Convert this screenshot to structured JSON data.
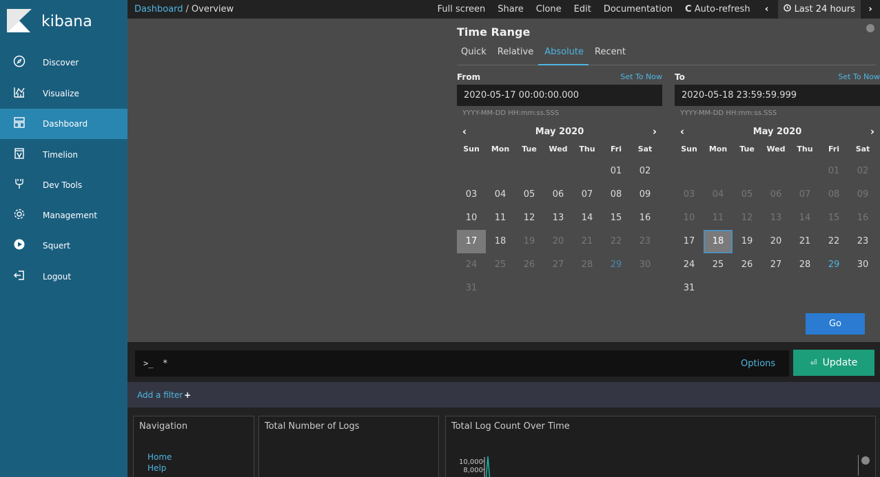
{
  "sidebar": {
    "brand": "kibana",
    "items": [
      {
        "label": "Discover",
        "icon": "compass-icon"
      },
      {
        "label": "Visualize",
        "icon": "chart-icon"
      },
      {
        "label": "Dashboard",
        "icon": "dashboard-icon"
      },
      {
        "label": "Timelion",
        "icon": "timelion-icon"
      },
      {
        "label": "Dev Tools",
        "icon": "wrench-icon"
      },
      {
        "label": "Management",
        "icon": "gear-icon"
      },
      {
        "label": "Squert",
        "icon": "play-icon"
      },
      {
        "label": "Logout",
        "icon": "logout-icon"
      }
    ],
    "active": "Dashboard"
  },
  "topbar": {
    "breadcrumb_link": "Dashboard",
    "breadcrumb_sep": "/",
    "breadcrumb_current": "Overview",
    "full_screen": "Full screen",
    "share": "Share",
    "clone": "Clone",
    "edit": "Edit",
    "documentation": "Documentation",
    "auto_refresh": "Auto-refresh",
    "time_label": "Last 24 hours"
  },
  "time_range": {
    "title": "Time Range",
    "tabs": [
      "Quick",
      "Relative",
      "Absolute",
      "Recent"
    ],
    "active_tab": "Absolute",
    "from": {
      "label": "From",
      "set_to_now": "Set To Now",
      "value": "2020-05-17 00:00:00.000",
      "format": "YYYY-MM-DD HH:mm:ss.SSS",
      "month": "May 2020",
      "selected": "17"
    },
    "to": {
      "label": "To",
      "set_to_now": "Set To Now",
      "value": "2020-05-18 23:59:59.999",
      "format": "YYYY-MM-DD HH:mm:ss.SSS",
      "month": "May 2020",
      "selected": "18"
    },
    "weekdays": [
      "Sun",
      "Mon",
      "Tue",
      "Wed",
      "Thu",
      "Fri",
      "Sat"
    ],
    "go": "Go"
  },
  "query": {
    "prompt": ">_",
    "value": "*",
    "options": "Options",
    "update": "Update"
  },
  "filter": {
    "add_filter": "Add a filter"
  },
  "dashboard": {
    "panels": [
      {
        "title": "Navigation",
        "links": [
          "Home",
          "Help"
        ]
      },
      {
        "title": "Total Number of Logs"
      },
      {
        "title": "Total Log Count Over Time"
      }
    ],
    "chart_data": {
      "type": "line",
      "y_ticks": [
        "10,000",
        "8,000"
      ]
    }
  },
  "colors": {
    "sidebar_bg": "#1a5e7e",
    "sidebar_active": "#2986b0",
    "link": "#4fb6e3",
    "go_button": "#2a7bd1",
    "update_button": "#1c9e7b",
    "chart_line": "#1fb3a8"
  }
}
